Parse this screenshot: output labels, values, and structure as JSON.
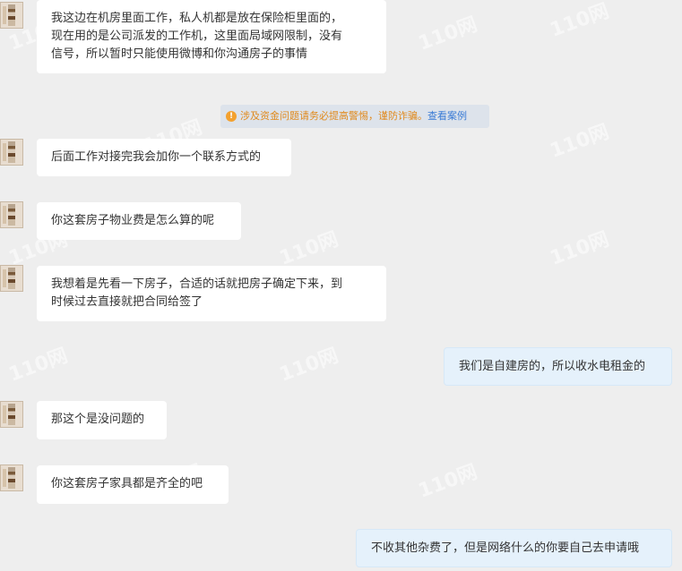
{
  "messages": [
    {
      "side": "left",
      "text": "我这边在机房里面工作，私人机都是放在保险柜里面的，\n现在用的是公司派发的工作机，这里面局域网限制，没有\n信号，所以暂时只能使用微博和你沟通房子的事情"
    },
    {
      "side": "left",
      "text": "后面工作对接完我会加你一个联系方式的"
    },
    {
      "side": "left",
      "text": "你这套房子物业费是怎么算的呢"
    },
    {
      "side": "left",
      "text": "我想着是先看一下房子，合适的话就把房子确定下来，到\n时候过去直接就把合同给签了"
    },
    {
      "side": "right",
      "text": "我们是自建房的，所以收水电租金的"
    },
    {
      "side": "left",
      "text": "那这个是没问题的"
    },
    {
      "side": "left",
      "text": "你这套房子家具都是齐全的吧"
    },
    {
      "side": "right",
      "text": "不收其他杂费了，但是网络什么的你要自己去申请哦"
    }
  ],
  "notice": {
    "icon": "info-icon",
    "text": "涉及资金问题请务必提高警惕，谨防诈骗。",
    "link": "查看案例"
  },
  "watermark": "110网",
  "colors": {
    "accent": "#e08a1e",
    "link": "#3a7bd5",
    "right_bubble": "#e5f1fb"
  }
}
